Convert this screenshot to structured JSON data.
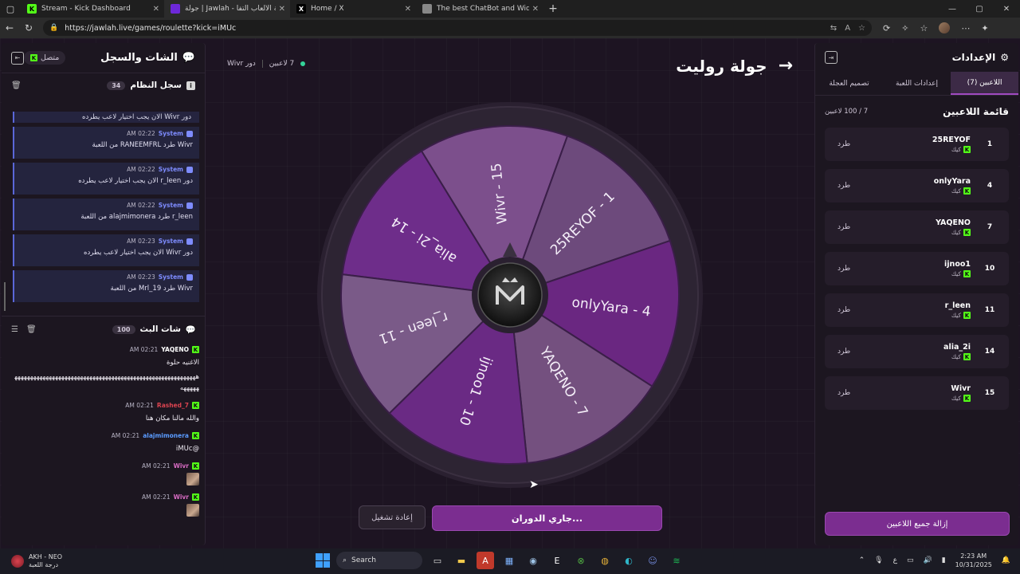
{
  "browser": {
    "tabs": [
      {
        "title": "Stream - Kick Dashboard",
        "icon": "K",
        "color": "#53fc18",
        "active": false
      },
      {
        "title": "جولة | Jawlah - منصة الألعاب التفا",
        "icon": "",
        "color": "#6d28d9",
        "active": true
      },
      {
        "title": "Home / X",
        "icon": "X",
        "color": "#000000",
        "active": false
      },
      {
        "title": "The best ChatBot and Widg",
        "icon": "",
        "color": "#888888",
        "active": false
      }
    ],
    "url": "https://jawlah.live/games/roulette?kick=iMUc"
  },
  "chat_panel": {
    "title": "الشات والسجل",
    "status": "متصل",
    "syslog_title": "سجل النظام",
    "syslog_count": "34",
    "syslog_partial": "دور Wivr الان يجب اختيار لاعب يطرده",
    "syslog": [
      {
        "sender": "System",
        "time": "02:22 AM",
        "text": "Wivr طرد RANEEMFRL من اللعبة"
      },
      {
        "sender": "System",
        "time": "02:22 AM",
        "text": "دور r_leen الان يجب اختيار لاعب يطرده"
      },
      {
        "sender": "System",
        "time": "02:22 AM",
        "text": "r_leen طرد alajmimonera من اللعبة"
      },
      {
        "sender": "System",
        "time": "02:23 AM",
        "text": "دور Wivr الان يجب اختيار لاعب يطرده"
      },
      {
        "sender": "System",
        "time": "02:23 AM",
        "text": "Wivr طرد Mrl_19 من اللعبة"
      }
    ],
    "livechat_title": "شات البث",
    "livechat_count": "100",
    "messages": [
      {
        "user": "YAQENO",
        "color": "#ffffff",
        "time": "02:21 AM",
        "text": "الاغنيه حلوة"
      },
      {
        "user": "",
        "color": "#ffffff",
        "time": "",
        "text": "ههههههههههههههههههههههههههههههههههههههههههههههههههههههههههههههههه"
      },
      {
        "user": "Rashed_7",
        "color": "#d9434f",
        "time": "02:21 AM",
        "text": "والله مالنا مكان هنا"
      },
      {
        "user": "alajmimonera",
        "color": "#5a9bff",
        "time": "02:21 AM",
        "text": "@iMUc"
      },
      {
        "user": "Wivr",
        "color": "#d96cc4",
        "time": "02:21 AM",
        "text": ""
      },
      {
        "user": "Wivr",
        "color": "#d96cc4",
        "time": "02:21 AM",
        "text": ""
      }
    ]
  },
  "game": {
    "title": "جولة روليت",
    "players_online": "7 لاعبين",
    "turn": "دور Wivr",
    "spin_button": "جاري الدوران...",
    "replay_button": "إعادة تشغيل"
  },
  "wheel": {
    "segments": [
      {
        "label": "alia_2i - 14",
        "color": "#6e2d8a"
      },
      {
        "label": "Wivr - 15",
        "color": "#7c4f8c"
      },
      {
        "label": "25REYOF - 1",
        "color": "#6d4a7c"
      },
      {
        "label": "onlyYara - 4",
        "color": "#6a2781"
      },
      {
        "label": "YAQENO - 7",
        "color": "#74507f"
      },
      {
        "label": "ijnoo1 - 10",
        "color": "#6a2a84"
      },
      {
        "label": "r_leen - 11",
        "color": "#7a5a88"
      }
    ]
  },
  "settings": {
    "title": "الإعدادات",
    "tabs": [
      "اللاعبين (7)",
      "إعدادات اللعبة",
      "تصميم العجلة"
    ],
    "list_title": "قائمة اللاعبين",
    "list_count": "7 / 100 لاعبين",
    "kick_label": "طرد",
    "platform": "كيك",
    "players": [
      {
        "num": "1",
        "name": "25REYOF"
      },
      {
        "num": "4",
        "name": "onlyYara"
      },
      {
        "num": "7",
        "name": "YAQENO"
      },
      {
        "num": "10",
        "name": "ijnoo1"
      },
      {
        "num": "11",
        "name": "r_leen"
      },
      {
        "num": "14",
        "name": "alia_2i"
      },
      {
        "num": "15",
        "name": "Wivr"
      }
    ],
    "remove_all": "إزالة جميع اللاعبين"
  },
  "taskbar": {
    "user": "AKH - NEO",
    "user_sub": "درجة اللعبة",
    "search": "Search",
    "time": "2:23 AM",
    "date": "10/31/2025",
    "lang": "ع"
  }
}
